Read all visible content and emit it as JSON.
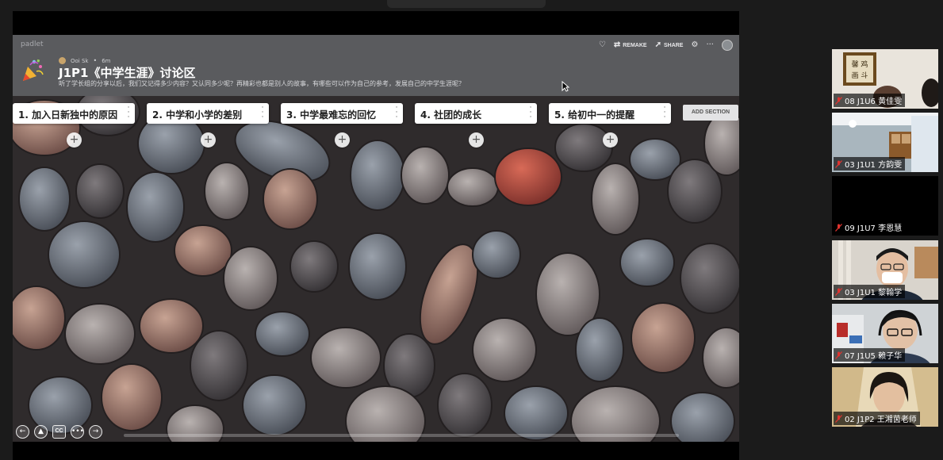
{
  "padlet": {
    "logo": "padlet",
    "author": "Ooi Sk",
    "time_ago": "6m",
    "title": "J1P1《中学生涯》讨论区",
    "description": "听了学长组的分享以后，我们又记得多少内容？又认同多少呢？再精彩也都是别人的故事，有哪些可以作为自己的参考，发展自己的中学生涯呢？",
    "actions": {
      "remake": "REMAKE",
      "share": "SHARE"
    },
    "icons": {
      "like": "heart-icon",
      "remake": "remake-icon",
      "share": "share-icon",
      "settings": "gear-icon",
      "more": "more-icon"
    },
    "sections": [
      {
        "title": "1. 加入日新独中的原因"
      },
      {
        "title": "2. 中学和小学的差别"
      },
      {
        "title": "3. 中学最难忘的回忆"
      },
      {
        "title": "4. 社团的成长"
      },
      {
        "title": "5. 给初中一的提醒"
      }
    ],
    "add_section_label": "ADD SECTION",
    "add_post_glyph": "+",
    "bottom_controls": {
      "back": "←",
      "cc": "CC",
      "more": "•••",
      "forward": "→"
    }
  },
  "participants": [
    {
      "name": "08 J1U6 黄佳雯",
      "muted": true
    },
    {
      "name": "03 J1U1 方韵雯",
      "muted": true
    },
    {
      "name": "09 J1U7 李恩慧",
      "muted": true
    },
    {
      "name": "03 J1U1 黎翰学",
      "muted": true
    },
    {
      "name": "07 J1U5 赖子华",
      "muted": true
    },
    {
      "name": "02 J1P2 王湘茵老师",
      "muted": true
    }
  ]
}
